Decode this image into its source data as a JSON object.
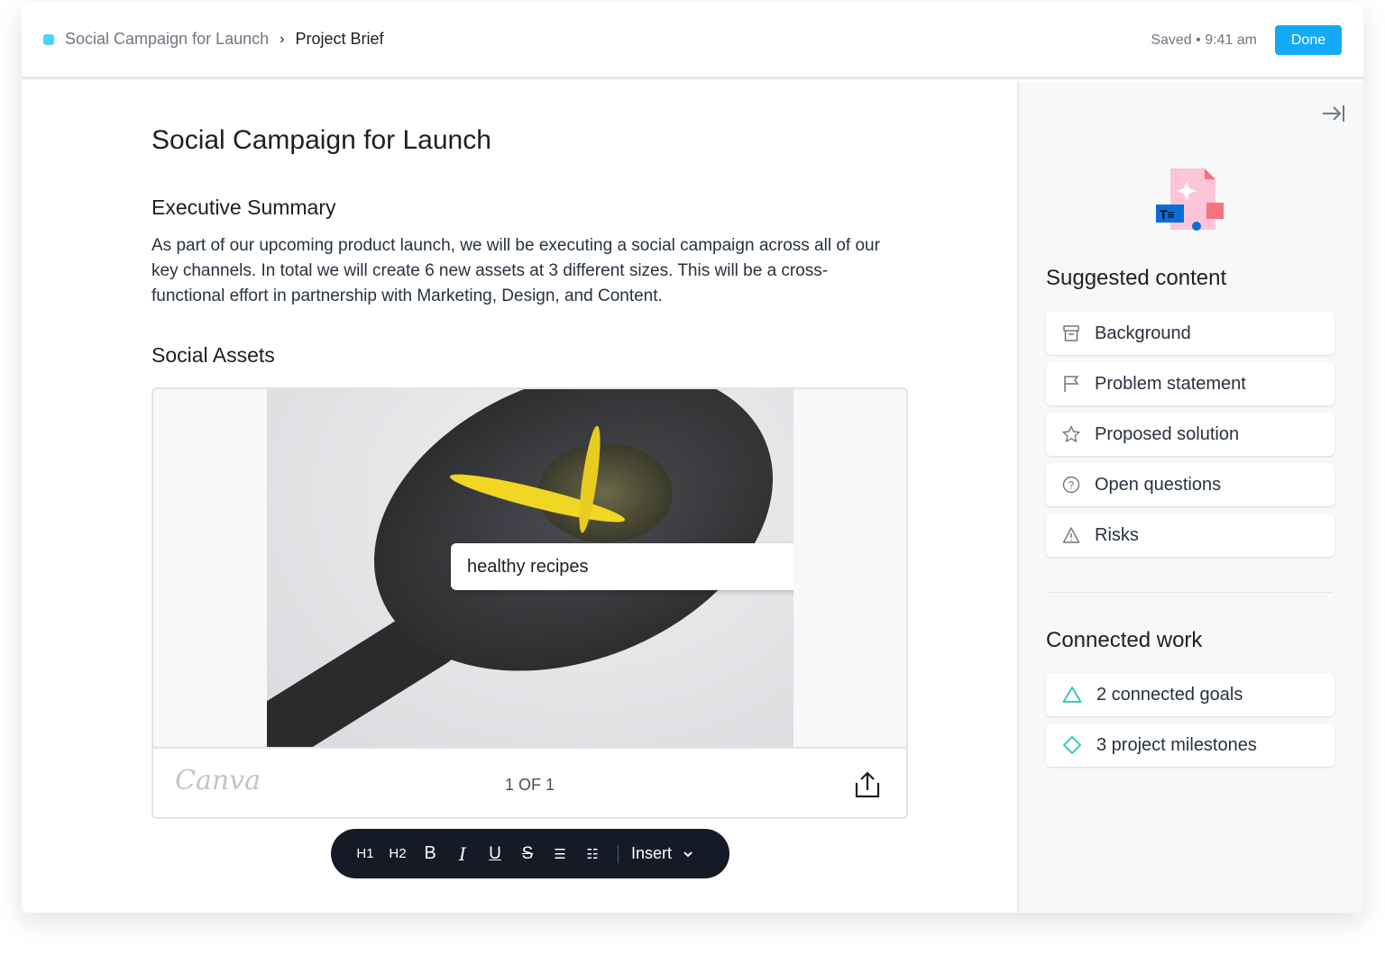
{
  "header": {
    "breadcrumb_parent": "Social Campaign for Launch",
    "breadcrumb_current": "Project Brief",
    "saved_status": "Saved • 9:41 am",
    "done_label": "Done",
    "project_color": "#4ad2fb"
  },
  "doc": {
    "title": "Social Campaign for Launch",
    "sections": [
      {
        "heading": "Executive Summary",
        "body": "As part of our upcoming product launch, we will be executing a social campaign across all of our key channels. In total we will create 6 new assets at 3 different sizes. This will be a cross-functional effort in partnership with Marketing, Design, and Content."
      },
      {
        "heading": "Social Assets"
      }
    ]
  },
  "embed": {
    "search_value": "healthy recipes",
    "brand": "Canva",
    "pager": "1 OF 1"
  },
  "toolbar": {
    "buttons": [
      "H1",
      "H2",
      "B",
      "I",
      "U",
      "S",
      "bulleted-list",
      "numbered-list"
    ],
    "insert_label": "Insert"
  },
  "sidebar": {
    "suggested_title": "Suggested content",
    "suggested": [
      {
        "label": "Background",
        "icon": "archive-icon"
      },
      {
        "label": "Problem statement",
        "icon": "flag-icon"
      },
      {
        "label": "Proposed solution",
        "icon": "star-icon"
      },
      {
        "label": "Open questions",
        "icon": "question-icon"
      },
      {
        "label": "Risks",
        "icon": "warning-icon"
      }
    ],
    "connected_title": "Connected work",
    "connected": [
      {
        "label": "2 connected goals",
        "icon": "goal-triangle-icon"
      },
      {
        "label": "3 project milestones",
        "icon": "milestone-diamond-icon"
      }
    ],
    "accent": "#25c9b0"
  }
}
